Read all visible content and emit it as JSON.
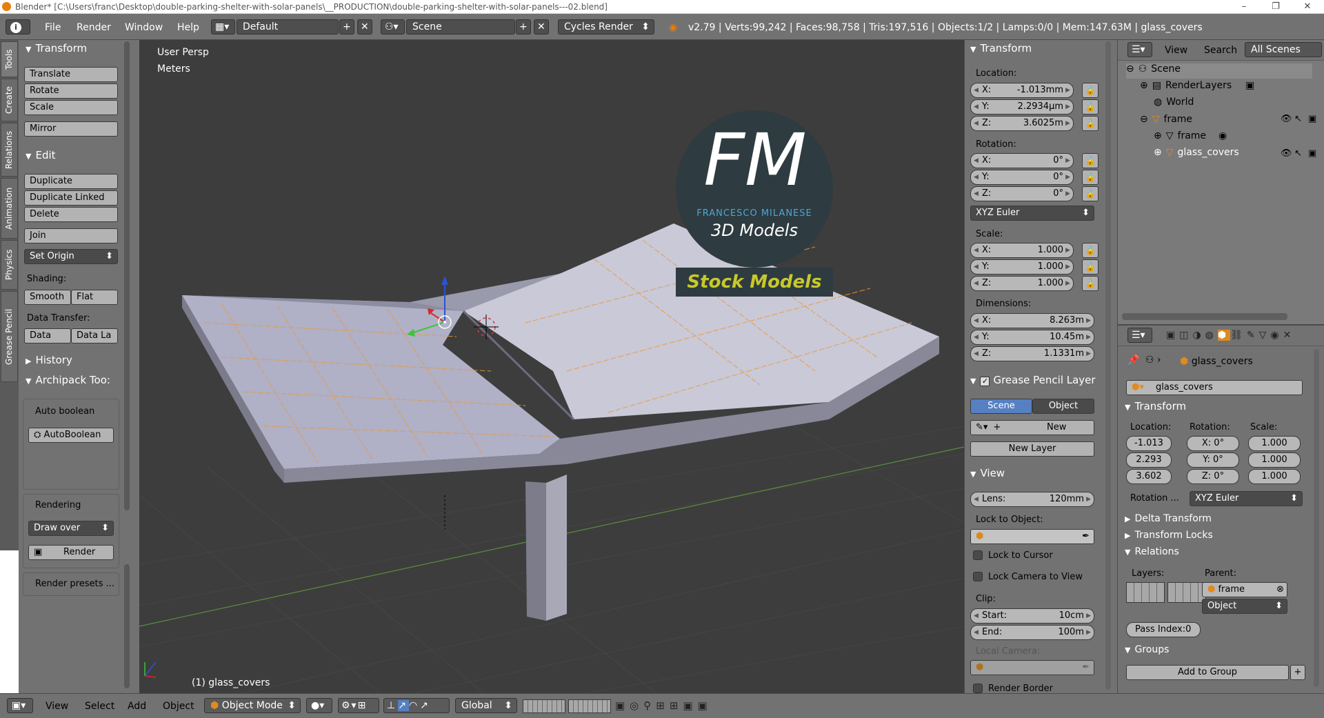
{
  "window": {
    "title": "Blender* [C:\\Users\\franc\\Desktop\\double-parking-shelter-with-solar-panels\\__PRODUCTION\\double-parking-shelter-with-solar-panels---02.blend]",
    "minimize": "–",
    "maximize": "❐",
    "close": "✕"
  },
  "infobar": {
    "info_icon": "i",
    "menus": [
      "File",
      "Render",
      "Window",
      "Help"
    ],
    "layout": "Default",
    "scene": "Scene",
    "engine": "Cycles Render",
    "stats": "v2.79 | Verts:99,242 | Faces:98,758 | Tris:197,516 | Objects:1/2 | Lamps:0/0 | Mem:147.63M | glass_covers"
  },
  "tool_tabs": [
    "Tools",
    "Create",
    "Relations",
    "Animation",
    "Physics",
    "Grease Pencil"
  ],
  "toolshelf": {
    "transform_header": "Transform",
    "translate": "Translate",
    "rotate": "Rotate",
    "scale": "Scale",
    "mirror": "Mirror",
    "edit_header": "Edit",
    "duplicate": "Duplicate",
    "duplicate_linked": "Duplicate Linked",
    "delete": "Delete",
    "join": "Join",
    "set_origin": "Set Origin",
    "shading_label": "Shading:",
    "smooth": "Smooth",
    "flat": "Flat",
    "data_transfer_label": "Data Transfer:",
    "data": "Data",
    "data_la": "Data La",
    "history_header": "History",
    "archipack_header": "Archipack Too:",
    "auto_boolean_label": "Auto boolean",
    "autoboolean_btn": "AutoBoolean",
    "rendering_label": "Rendering",
    "draw_over": "Draw over",
    "render_btn": "Render",
    "render_presets": "Render presets ..."
  },
  "viewport": {
    "view_name": "User Persp",
    "units": "Meters",
    "object_label": "(1) glass_covers",
    "watermark_big": "FM",
    "watermark_name": "FRANCESCO MILANESE",
    "watermark_sub": "3D Models",
    "watermark_stock": "Stock Models"
  },
  "properties_n": {
    "transform_header": "Transform",
    "location_label": "Location:",
    "loc": [
      {
        "axis": "X:",
        "value": "-1.013mm"
      },
      {
        "axis": "Y:",
        "value": "2.2934µm"
      },
      {
        "axis": "Z:",
        "value": "3.6025m"
      }
    ],
    "rotation_label": "Rotation:",
    "rot": [
      {
        "axis": "X:",
        "value": "0°"
      },
      {
        "axis": "Y:",
        "value": "0°"
      },
      {
        "axis": "Z:",
        "value": "0°"
      }
    ],
    "rotation_mode": "XYZ Euler",
    "scale_label": "Scale:",
    "scale": [
      {
        "axis": "X:",
        "value": "1.000"
      },
      {
        "axis": "Y:",
        "value": "1.000"
      },
      {
        "axis": "Z:",
        "value": "1.000"
      }
    ],
    "dimensions_label": "Dimensions:",
    "dim": [
      {
        "axis": "X:",
        "value": "8.263m"
      },
      {
        "axis": "Y:",
        "value": "10.45m"
      },
      {
        "axis": "Z:",
        "value": "1.1331m"
      }
    ],
    "gp_header": "Grease Pencil Layer",
    "gp_scene": "Scene",
    "gp_object": "Object",
    "gp_new": "New",
    "gp_new_layer": "New Layer",
    "view_header": "View",
    "lens_label": "Lens:",
    "lens_value": "120mm",
    "lock_object_label": "Lock to Object:",
    "lock_cursor": "Lock to Cursor",
    "lock_camera": "Lock Camera to View",
    "clip_label": "Clip:",
    "clip_start_label": "Start:",
    "clip_start": "10cm",
    "clip_end_label": "End:",
    "clip_end": "100m",
    "local_camera": "Local Camera:",
    "render_border": "Render Border"
  },
  "outliner": {
    "view": "View",
    "search": "Search",
    "all_scenes": "All Scenes",
    "items": [
      {
        "label": "Scene",
        "icon": "scene-icon"
      },
      {
        "label": "RenderLayers",
        "icon": "renderlayers-icon"
      },
      {
        "label": "World",
        "icon": "world-icon"
      },
      {
        "label": "frame",
        "icon": "object-icon"
      },
      {
        "label": "frame",
        "icon": "mesh-icon"
      },
      {
        "label": "glass_covers",
        "icon": "object-icon"
      }
    ]
  },
  "properties": {
    "breadcrumb_object": "glass_covers",
    "object_name": "glass_covers",
    "transform_header": "Transform",
    "location_label": "Location:",
    "rotation_label": "Rotation:",
    "scale_label": "Scale:",
    "loc": [
      "-1.013",
      "2.293",
      "3.602"
    ],
    "rot": [
      "X:  0°",
      "Y:  0°",
      "Z:  0°"
    ],
    "scale": [
      "1.000",
      "1.000",
      "1.000"
    ],
    "rotation_mode_label": "Rotation ...",
    "rotation_mode": "XYZ Euler",
    "delta_transform": "Delta Transform",
    "transform_locks": "Transform Locks",
    "relations": "Relations",
    "layers_label": "Layers:",
    "parent_label": "Parent:",
    "parent_value": "frame",
    "parent_type": "Object",
    "pass_index": "Pass Index:0",
    "groups": "Groups",
    "add_to_group": "Add to Group"
  },
  "bottombar": {
    "menus": [
      "View",
      "Select",
      "Add",
      "Object"
    ],
    "mode": "Object Mode",
    "orientation": "Global"
  }
}
